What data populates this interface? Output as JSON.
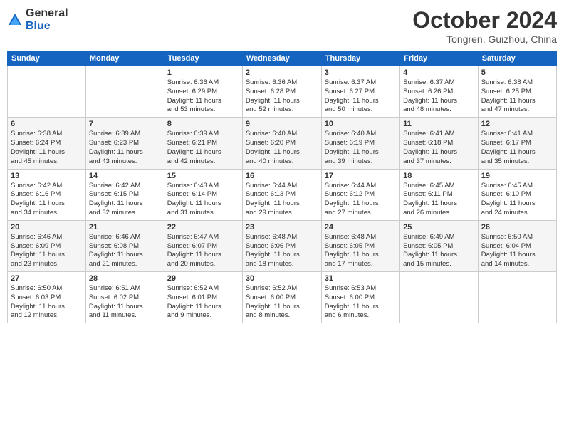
{
  "logo": {
    "general": "General",
    "blue": "Blue"
  },
  "title": "October 2024",
  "location": "Tongren, Guizhou, China",
  "days": [
    "Sunday",
    "Monday",
    "Tuesday",
    "Wednesday",
    "Thursday",
    "Friday",
    "Saturday"
  ],
  "weeks": [
    [
      {
        "num": "",
        "lines": []
      },
      {
        "num": "",
        "lines": []
      },
      {
        "num": "1",
        "lines": [
          "Sunrise: 6:36 AM",
          "Sunset: 6:29 PM",
          "Daylight: 11 hours",
          "and 53 minutes."
        ]
      },
      {
        "num": "2",
        "lines": [
          "Sunrise: 6:36 AM",
          "Sunset: 6:28 PM",
          "Daylight: 11 hours",
          "and 52 minutes."
        ]
      },
      {
        "num": "3",
        "lines": [
          "Sunrise: 6:37 AM",
          "Sunset: 6:27 PM",
          "Daylight: 11 hours",
          "and 50 minutes."
        ]
      },
      {
        "num": "4",
        "lines": [
          "Sunrise: 6:37 AM",
          "Sunset: 6:26 PM",
          "Daylight: 11 hours",
          "and 48 minutes."
        ]
      },
      {
        "num": "5",
        "lines": [
          "Sunrise: 6:38 AM",
          "Sunset: 6:25 PM",
          "Daylight: 11 hours",
          "and 47 minutes."
        ]
      }
    ],
    [
      {
        "num": "6",
        "lines": [
          "Sunrise: 6:38 AM",
          "Sunset: 6:24 PM",
          "Daylight: 11 hours",
          "and 45 minutes."
        ]
      },
      {
        "num": "7",
        "lines": [
          "Sunrise: 6:39 AM",
          "Sunset: 6:23 PM",
          "Daylight: 11 hours",
          "and 43 minutes."
        ]
      },
      {
        "num": "8",
        "lines": [
          "Sunrise: 6:39 AM",
          "Sunset: 6:21 PM",
          "Daylight: 11 hours",
          "and 42 minutes."
        ]
      },
      {
        "num": "9",
        "lines": [
          "Sunrise: 6:40 AM",
          "Sunset: 6:20 PM",
          "Daylight: 11 hours",
          "and 40 minutes."
        ]
      },
      {
        "num": "10",
        "lines": [
          "Sunrise: 6:40 AM",
          "Sunset: 6:19 PM",
          "Daylight: 11 hours",
          "and 39 minutes."
        ]
      },
      {
        "num": "11",
        "lines": [
          "Sunrise: 6:41 AM",
          "Sunset: 6:18 PM",
          "Daylight: 11 hours",
          "and 37 minutes."
        ]
      },
      {
        "num": "12",
        "lines": [
          "Sunrise: 6:41 AM",
          "Sunset: 6:17 PM",
          "Daylight: 11 hours",
          "and 35 minutes."
        ]
      }
    ],
    [
      {
        "num": "13",
        "lines": [
          "Sunrise: 6:42 AM",
          "Sunset: 6:16 PM",
          "Daylight: 11 hours",
          "and 34 minutes."
        ]
      },
      {
        "num": "14",
        "lines": [
          "Sunrise: 6:42 AM",
          "Sunset: 6:15 PM",
          "Daylight: 11 hours",
          "and 32 minutes."
        ]
      },
      {
        "num": "15",
        "lines": [
          "Sunrise: 6:43 AM",
          "Sunset: 6:14 PM",
          "Daylight: 11 hours",
          "and 31 minutes."
        ]
      },
      {
        "num": "16",
        "lines": [
          "Sunrise: 6:44 AM",
          "Sunset: 6:13 PM",
          "Daylight: 11 hours",
          "and 29 minutes."
        ]
      },
      {
        "num": "17",
        "lines": [
          "Sunrise: 6:44 AM",
          "Sunset: 6:12 PM",
          "Daylight: 11 hours",
          "and 27 minutes."
        ]
      },
      {
        "num": "18",
        "lines": [
          "Sunrise: 6:45 AM",
          "Sunset: 6:11 PM",
          "Daylight: 11 hours",
          "and 26 minutes."
        ]
      },
      {
        "num": "19",
        "lines": [
          "Sunrise: 6:45 AM",
          "Sunset: 6:10 PM",
          "Daylight: 11 hours",
          "and 24 minutes."
        ]
      }
    ],
    [
      {
        "num": "20",
        "lines": [
          "Sunrise: 6:46 AM",
          "Sunset: 6:09 PM",
          "Daylight: 11 hours",
          "and 23 minutes."
        ]
      },
      {
        "num": "21",
        "lines": [
          "Sunrise: 6:46 AM",
          "Sunset: 6:08 PM",
          "Daylight: 11 hours",
          "and 21 minutes."
        ]
      },
      {
        "num": "22",
        "lines": [
          "Sunrise: 6:47 AM",
          "Sunset: 6:07 PM",
          "Daylight: 11 hours",
          "and 20 minutes."
        ]
      },
      {
        "num": "23",
        "lines": [
          "Sunrise: 6:48 AM",
          "Sunset: 6:06 PM",
          "Daylight: 11 hours",
          "and 18 minutes."
        ]
      },
      {
        "num": "24",
        "lines": [
          "Sunrise: 6:48 AM",
          "Sunset: 6:05 PM",
          "Daylight: 11 hours",
          "and 17 minutes."
        ]
      },
      {
        "num": "25",
        "lines": [
          "Sunrise: 6:49 AM",
          "Sunset: 6:05 PM",
          "Daylight: 11 hours",
          "and 15 minutes."
        ]
      },
      {
        "num": "26",
        "lines": [
          "Sunrise: 6:50 AM",
          "Sunset: 6:04 PM",
          "Daylight: 11 hours",
          "and 14 minutes."
        ]
      }
    ],
    [
      {
        "num": "27",
        "lines": [
          "Sunrise: 6:50 AM",
          "Sunset: 6:03 PM",
          "Daylight: 11 hours",
          "and 12 minutes."
        ]
      },
      {
        "num": "28",
        "lines": [
          "Sunrise: 6:51 AM",
          "Sunset: 6:02 PM",
          "Daylight: 11 hours",
          "and 11 minutes."
        ]
      },
      {
        "num": "29",
        "lines": [
          "Sunrise: 6:52 AM",
          "Sunset: 6:01 PM",
          "Daylight: 11 hours",
          "and 9 minutes."
        ]
      },
      {
        "num": "30",
        "lines": [
          "Sunrise: 6:52 AM",
          "Sunset: 6:00 PM",
          "Daylight: 11 hours",
          "and 8 minutes."
        ]
      },
      {
        "num": "31",
        "lines": [
          "Sunrise: 6:53 AM",
          "Sunset: 6:00 PM",
          "Daylight: 11 hours",
          "and 6 minutes."
        ]
      },
      {
        "num": "",
        "lines": []
      },
      {
        "num": "",
        "lines": []
      }
    ]
  ]
}
